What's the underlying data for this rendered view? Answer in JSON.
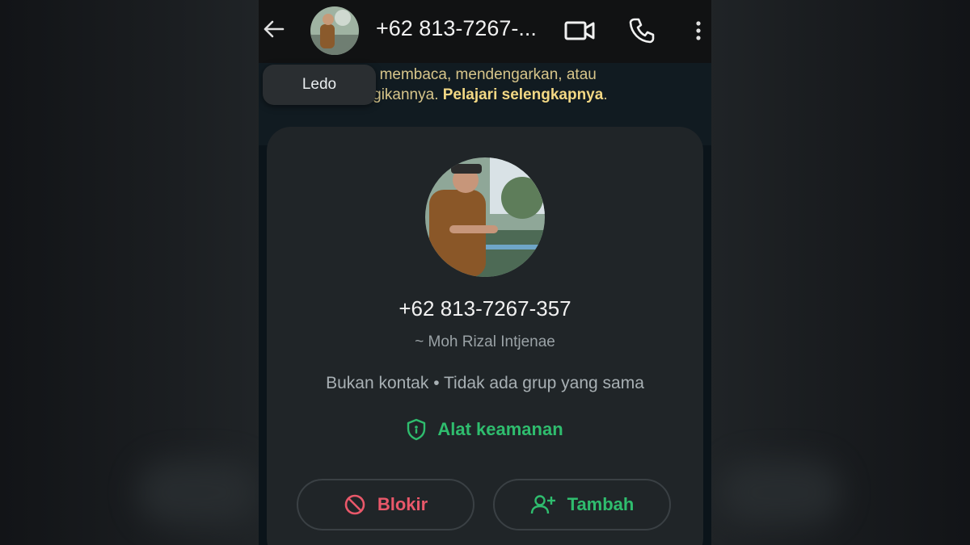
{
  "header": {
    "title": "+62 813-7267-...",
    "tooltip": "Ledo"
  },
  "notice": {
    "text_part": "isa membaca, mendengarkan, atau",
    "text_part2": "bagikannya. ",
    "link": "Pelajari selengkapnya",
    "end": "."
  },
  "profile": {
    "phone_number": "+62 813-7267-357",
    "push_name": "~ Moh Rizal Intjenae",
    "info": "Bukan kontak • Tidak ada grup yang sama",
    "security_label": "Alat keamanan"
  },
  "actions": {
    "block_label": "Blokir",
    "add_label": "Tambah"
  },
  "colors": {
    "accent_green": "#2fbd6e",
    "danger_red": "#e9586a",
    "notice_yellow": "#d7c58a"
  },
  "icons": {
    "back": "arrow-left",
    "video": "video-camera",
    "call": "phone",
    "menu": "more-vertical",
    "security": "shield",
    "block": "block-circle",
    "add": "person-add"
  }
}
